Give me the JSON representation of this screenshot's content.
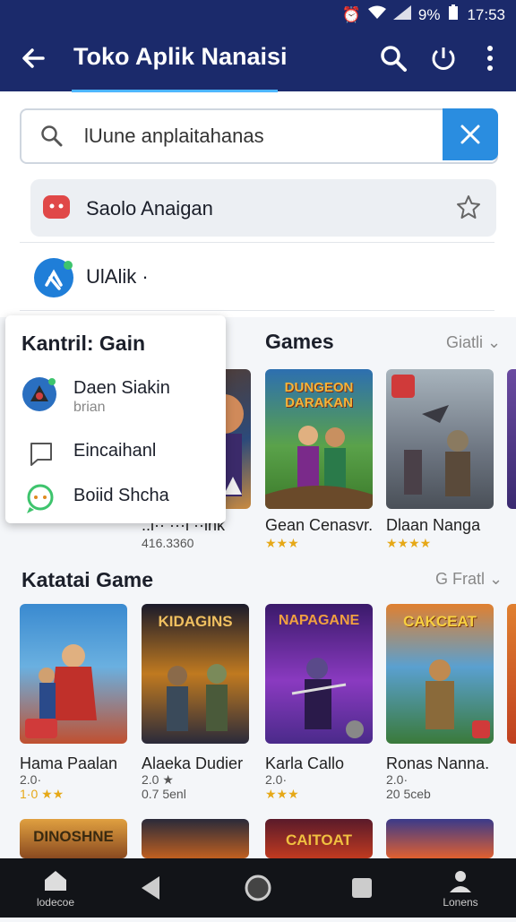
{
  "status_bar": {
    "battery_text": "9%",
    "time": "17:53"
  },
  "app_bar": {
    "title": "Toko Aplik Nanaisi"
  },
  "search": {
    "value": "lUune anplaitahanas"
  },
  "suggestions": [
    {
      "label": "Saolo Anaigan"
    },
    {
      "label": "UlAlik ·"
    }
  ],
  "popup": {
    "title": "Kantril: Gain",
    "items": [
      {
        "label": "Daen Siakin",
        "sub": "brian"
      },
      {
        "label": "Eincaihanl"
      },
      {
        "label": "Boiid Shcha"
      }
    ]
  },
  "games_section": {
    "title": "Games",
    "more_label": "Giatli",
    "tiles": [
      {
        "name": "..l·· ···l ··ink",
        "meta": "416.3360"
      },
      {
        "name": "Gean Cenasvr.",
        "meta": "★★★"
      },
      {
        "name": "Dlaan Nanga",
        "meta": "★★★★"
      }
    ]
  },
  "katatai_section": {
    "title": "Katatai Game",
    "more_label": "G Fratl",
    "tiles": [
      {
        "name": "Hama Paalan",
        "rating": "2.0·",
        "meta": "1·0 ★★",
        "art_title": ""
      },
      {
        "name": "Alaeka Dudier",
        "rating": "2.0 ★",
        "meta": "0.7 5enl",
        "art_title": "KIDAGINS"
      },
      {
        "name": "Karla Callo",
        "rating": "2.0·",
        "meta": "★★★",
        "art_title": "NAPAGANE"
      },
      {
        "name": "Ronas Nanna.",
        "rating": "2.0·",
        "meta": "20 5ceb",
        "art_title": "CAKCEAT"
      }
    ]
  },
  "art_titles": {
    "dungeon": "DUNGEON DARAKAN",
    "bottom_1": "DINOSHNE",
    "bottom_2": "CAITOAT"
  },
  "nav_bar": {
    "home_label": "lodecoe",
    "profile_label": "Lonens"
  },
  "colors": {
    "app_bar": "#1b2a6b",
    "accent": "#2a8de0",
    "star": "#e6a817"
  }
}
